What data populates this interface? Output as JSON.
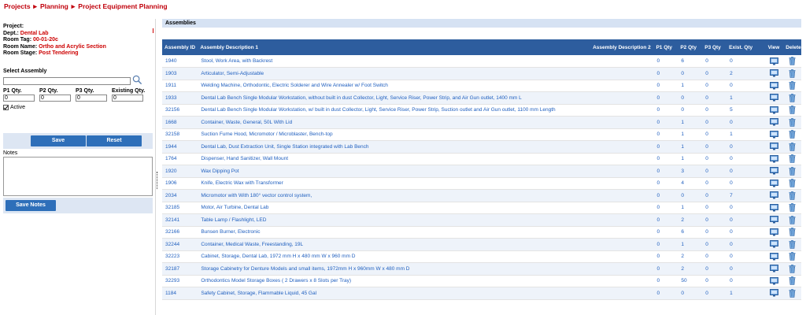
{
  "breadcrumb": [
    "Projects",
    "Planning",
    "Project Equipment Planning"
  ],
  "breadcrumb_sep": "►",
  "info": {
    "project_label": "Project:",
    "project_value": "",
    "dept_label": "Dept.:",
    "dept_value": "Dental Lab",
    "roomtag_label": "Room Tag:",
    "roomtag_value": "00-01-20c",
    "roomname_label": "Room Name:",
    "roomname_value": "Ortho and Acrylic Section",
    "stage_label": "Room Stage:",
    "stage_value": "Post Tendering"
  },
  "select_assembly": {
    "label": "Select Assembly",
    "search_value": "",
    "p1_label": "P1 Qty.",
    "p1_value": "0",
    "p2_label": "P2 Qty.",
    "p2_value": "0",
    "p3_label": "P3 Qty.",
    "p3_value": "0",
    "existing_label": "Existing Qty.",
    "existing_value": "0",
    "active_label": "Active"
  },
  "buttons": {
    "save": "Save",
    "reset": "Reset",
    "save_notes": "Save Notes"
  },
  "notes_label": "Notes",
  "panel_title": "Assemblies",
  "table": {
    "headers": [
      "Assembly ID",
      "Assembly Description 1",
      "Assembly Description 2",
      "P1 Qty",
      "P2 Qty",
      "P3 Qty",
      "Exist. Qty",
      "View",
      "Delete"
    ],
    "rows": [
      {
        "id": "1940",
        "desc1": "Stool, Work Area, with Backrest",
        "desc2": "",
        "p1": "0",
        "p2": "6",
        "p3": "0",
        "ex": "0"
      },
      {
        "id": "1903",
        "desc1": "Articulator, Semi-Adjustable",
        "desc2": "",
        "p1": "0",
        "p2": "0",
        "p3": "0",
        "ex": "2"
      },
      {
        "id": "1911",
        "desc1": "Welding Machine, Orthodontic, Electric Solderer and Wire Annealer w/ Foot Switch",
        "desc2": "",
        "p1": "0",
        "p2": "1",
        "p3": "0",
        "ex": "0"
      },
      {
        "id": "1933",
        "desc1": "Dental Lab Bench Single Modular Workstation, without built in dust Collector, Light, Service Riser, Power Strip, and Air Gun outlet, 1400 mm L",
        "desc2": "",
        "p1": "0",
        "p2": "0",
        "p3": "0",
        "ex": "1"
      },
      {
        "id": "32156",
        "desc1": "Dental Lab Bench Single Modular Workstation, w/ built in dust Collector, Light, Service Riser, Power Strip, Suction outlet and Air Gun outlet, 1100 mm Length",
        "desc2": "",
        "p1": "0",
        "p2": "0",
        "p3": "0",
        "ex": "5"
      },
      {
        "id": "1668",
        "desc1": "Container, Waste, General, 50L With Lid",
        "desc2": "",
        "p1": "0",
        "p2": "1",
        "p3": "0",
        "ex": "0"
      },
      {
        "id": "32158",
        "desc1": "Suction Fume Hood, Micromotor / Microblaster, Bench-top",
        "desc2": "",
        "p1": "0",
        "p2": "1",
        "p3": "0",
        "ex": "1"
      },
      {
        "id": "1944",
        "desc1": "Dental Lab, Dust Extraction Unit, Single Station integrated with Lab Bench",
        "desc2": "",
        "p1": "0",
        "p2": "1",
        "p3": "0",
        "ex": "0"
      },
      {
        "id": "1764",
        "desc1": "Dispenser, Hand Sanitizer, Wall Mount",
        "desc2": "",
        "p1": "0",
        "p2": "1",
        "p3": "0",
        "ex": "0"
      },
      {
        "id": "1920",
        "desc1": "Wax Dipping Pot",
        "desc2": "",
        "p1": "0",
        "p2": "3",
        "p3": "0",
        "ex": "0"
      },
      {
        "id": "1906",
        "desc1": "Knife, Electric Wax with Transformer",
        "desc2": "",
        "p1": "0",
        "p2": "4",
        "p3": "0",
        "ex": "0"
      },
      {
        "id": "2034",
        "desc1": "Micromotor with With 180° vector control system,",
        "desc2": "",
        "p1": "0",
        "p2": "0",
        "p3": "0",
        "ex": "7"
      },
      {
        "id": "32185",
        "desc1": "Motor, Air Turbine, Dental Lab",
        "desc2": "",
        "p1": "0",
        "p2": "1",
        "p3": "0",
        "ex": "0"
      },
      {
        "id": "32141",
        "desc1": "Table Lamp / Flashlight, LED",
        "desc2": "",
        "p1": "0",
        "p2": "2",
        "p3": "0",
        "ex": "0"
      },
      {
        "id": "32166",
        "desc1": "Bunsen Burner, Electronic",
        "desc2": "",
        "p1": "0",
        "p2": "6",
        "p3": "0",
        "ex": "0"
      },
      {
        "id": "32244",
        "desc1": "Container, Medical Waste, Freestanding, 19L",
        "desc2": "",
        "p1": "0",
        "p2": "1",
        "p3": "0",
        "ex": "0"
      },
      {
        "id": "32223",
        "desc1": "Cabinet, Storage, Dental Lab, 1972 mm H x 480 mm W x 960 mm D",
        "desc2": "",
        "p1": "0",
        "p2": "2",
        "p3": "0",
        "ex": "0"
      },
      {
        "id": "32187",
        "desc1": "Storage Cabinetry for Denture Models and small items, 1972mm H x 960mm W x 480 mm D",
        "desc2": "",
        "p1": "0",
        "p2": "2",
        "p3": "0",
        "ex": "0"
      },
      {
        "id": "32293",
        "desc1": "Orthodontics Model Storage Boxes ( 2 Drawers x 8 Slots per Tray)",
        "desc2": "",
        "p1": "0",
        "p2": "50",
        "p3": "0",
        "ex": "0"
      },
      {
        "id": "1184",
        "desc1": "Safety Cabinet, Storage, Flammable Liquid, 45 Gal",
        "desc2": "",
        "p1": "0",
        "p2": "0",
        "p3": "0",
        "ex": "1"
      }
    ]
  },
  "colors": {
    "header": "#2d5d9e",
    "accent_red": "#c0000b",
    "link": "#1f5fbf",
    "button": "#2e6fb9",
    "panel": "#d6e2f3"
  },
  "icons": {
    "search": "magnifier-icon",
    "view": "monitor-icon",
    "delete": "trash-icon"
  }
}
